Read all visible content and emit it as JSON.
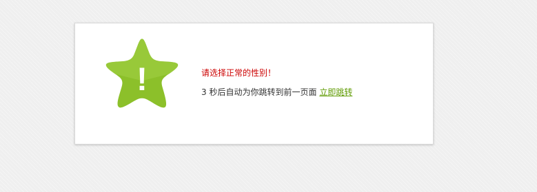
{
  "dialog": {
    "icon": "warning-star-icon",
    "icon_glyph": "!",
    "icon_color": "#8cc02a",
    "message": "请选择正常的性别！",
    "message_color": "#cc0000",
    "countdown_number": "3",
    "countdown_text": "秒后自动为你跳转到前一页面",
    "redirect_link_label": "立即跳转",
    "link_color": "#5e9a00"
  }
}
